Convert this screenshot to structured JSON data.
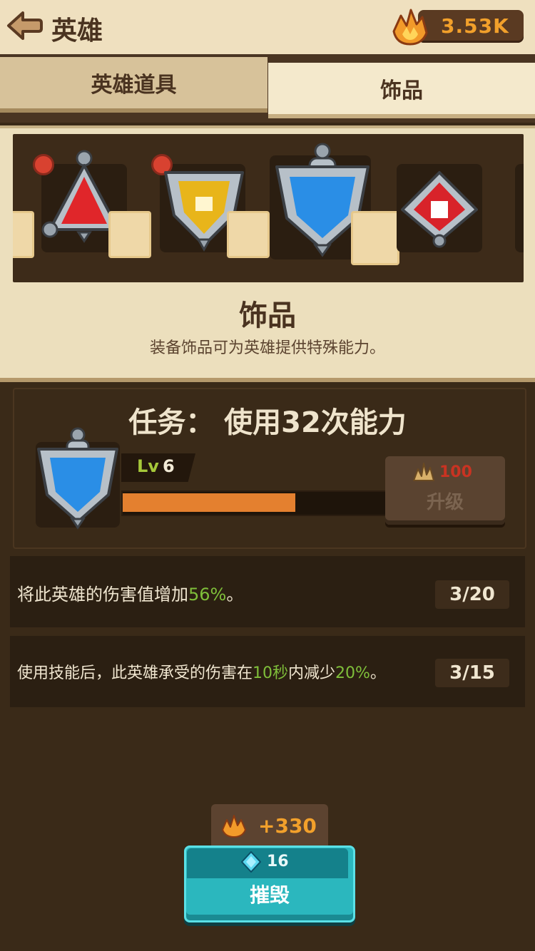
{
  "header": {
    "title": "英雄",
    "currency": "3.53K"
  },
  "tabs": [
    {
      "label": "英雄道具",
      "active": false
    },
    {
      "label": "饰品",
      "active": true
    }
  ],
  "section": {
    "title": "饰品",
    "description": "装备饰品可为英雄提供特殊能力。"
  },
  "quest": {
    "title": "任务： 使用32次能力",
    "level_prefix": "Lv",
    "level": "6",
    "progress_percent": 65,
    "upgrade_cost": "100",
    "upgrade_label": "升级"
  },
  "effects": [
    {
      "text_before": "将此英雄的伤害值增加",
      "highlight": "56%",
      "text_after": "。",
      "highlight2": "",
      "text_mid": "",
      "counter": "3/20"
    },
    {
      "text_before": "使用技能后，此英雄承受的伤害在",
      "highlight": "10秒",
      "text_mid": "内减少",
      "highlight2": "20%",
      "text_after": "。",
      "counter": "3/15"
    }
  ],
  "bottom": {
    "reward": "+330",
    "gem_cost": "16",
    "destroy_label": "摧毁"
  },
  "colors": {
    "accent_orange": "#e4802f",
    "highlight_green": "#7fbf3a",
    "teal_button": "#2bb7be",
    "cost_red": "#c93322"
  }
}
